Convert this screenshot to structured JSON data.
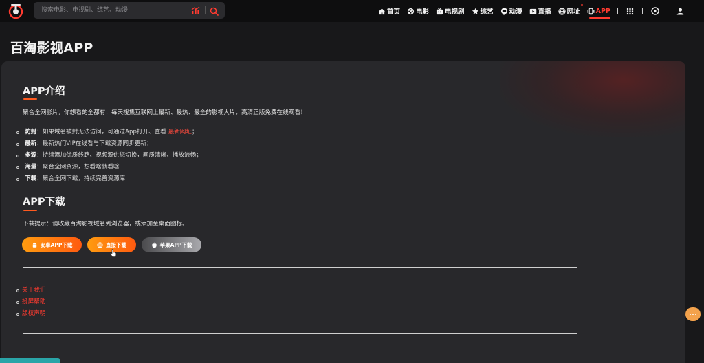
{
  "search": {
    "placeholder": "搜索电影、电视剧、综艺、动漫"
  },
  "nav": {
    "items": [
      {
        "label": "首页",
        "icon": "home-icon"
      },
      {
        "label": "电影",
        "icon": "film-reel-icon"
      },
      {
        "label": "电视剧",
        "icon": "tv-icon"
      },
      {
        "label": "综艺",
        "icon": "star-icon"
      },
      {
        "label": "动漫",
        "icon": "mascot-icon"
      },
      {
        "label": "直播",
        "icon": "live-icon"
      },
      {
        "label": "网址",
        "icon": "globe-icon"
      },
      {
        "label": "APP",
        "icon": "phone-icon",
        "active": true
      }
    ]
  },
  "page": {
    "title": "百淘影视APP"
  },
  "intro": {
    "title": "APP介绍",
    "description": "聚合全网影片，你想看的全都有！每天搜集互联网上最新、最热、最全的影视大片，高清正版免费在线观看！",
    "features": [
      {
        "name": "防封",
        "text": "：如果域名被封无法访问，可通过App打开、查看 ",
        "link": "最新网址",
        "tail": "；"
      },
      {
        "name": "最新",
        "text": "：最新热门VIP在线看与下载资源同步更新；"
      },
      {
        "name": "多源",
        "text": "：持续添加优质线路、视频源供您切换，画质清晰、播放流畅；"
      },
      {
        "name": "海量",
        "text": "：聚合全网资源，想看啥就看啥"
      },
      {
        "name": "下载",
        "text": "：聚合全网下载，持续完善资源库"
      }
    ]
  },
  "download": {
    "title": "APP下载",
    "tip": "下载提示：请收藏百淘影视域名到浏览器，或添加至桌面图标。",
    "buttons": {
      "android": "安卓APP下载",
      "direct": "直接下载",
      "ios": "苹果APP下载"
    }
  },
  "footer_links": [
    "关于我们",
    "投屏帮助",
    "版权声明"
  ],
  "colors": {
    "accent": "#ff3b30",
    "orange_start": "#ff9c10",
    "orange_end": "#ff5a10"
  }
}
